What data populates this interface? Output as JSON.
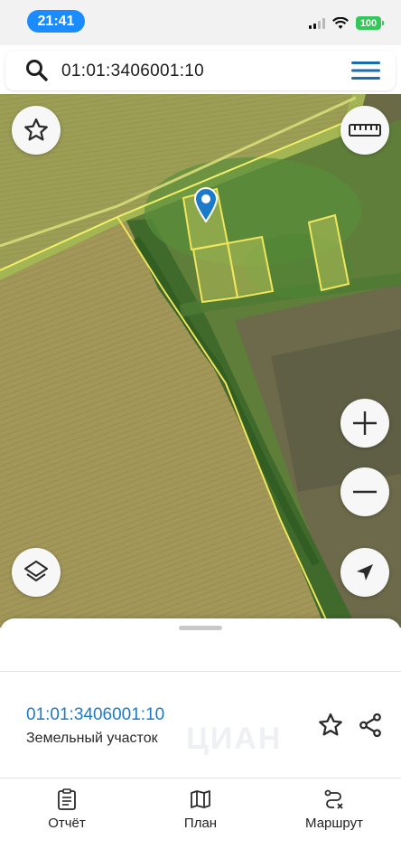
{
  "status_bar": {
    "time": "21:41",
    "battery": "100",
    "time_pill_color": "#1a8cff",
    "battery_color": "#34c759"
  },
  "search": {
    "query": "01:01:3406001:10",
    "icons": [
      "search-icon",
      "menu-icon"
    ]
  },
  "map": {
    "buttons": [
      "favorite-icon",
      "ruler-icon",
      "zoom-in-icon",
      "zoom-out-icon",
      "layers-icon",
      "locate-icon"
    ],
    "marker_color": "#1b7ac9",
    "outline_color": "#e8e35a"
  },
  "card": {
    "cadastral_number": "01:01:3406001:10",
    "type": "Земельный участок",
    "watermark": "ЦИАН",
    "link_color": "#1b7ac9"
  },
  "tabs": [
    {
      "label": "Отчёт",
      "icon": "clipboard-icon"
    },
    {
      "label": "План",
      "icon": "map-icon"
    },
    {
      "label": "Маршрут",
      "icon": "route-icon"
    }
  ]
}
